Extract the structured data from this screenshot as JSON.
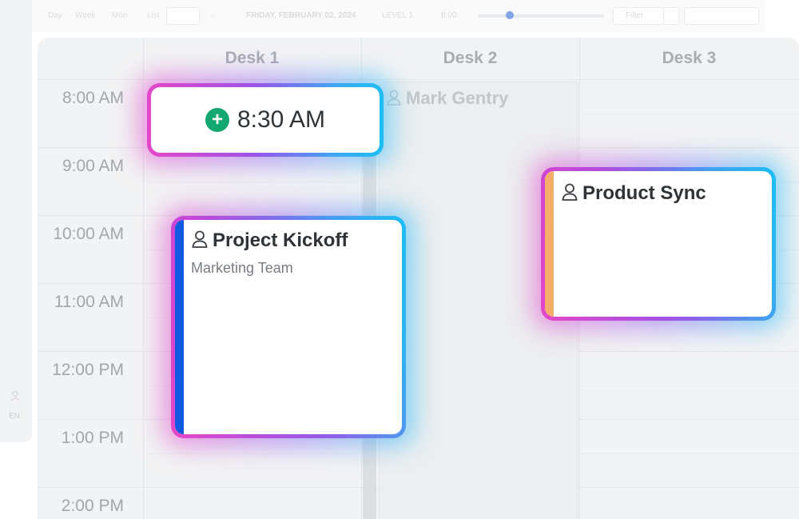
{
  "sidebar": {
    "language_code": "EN"
  },
  "toolbar": {
    "day_label": "Day",
    "week_label": "Week",
    "month_label": "Mon",
    "list_label": "List",
    "date_text": "FRIDAY, FEBRUARY 02, 2024",
    "level_label": "LEVEL 1",
    "time_label": "8:00",
    "filter_label": "Filter",
    "zoom_fraction": 0.25
  },
  "calendar": {
    "desks": [
      "Desk 1",
      "Desk 2",
      "Desk 3"
    ],
    "times": [
      "8:00 AM",
      "9:00 AM",
      "10:00 AM",
      "11:00 AM",
      "12:00 PM",
      "1:00 PM",
      "2:00 PM"
    ],
    "desk2_booking": {
      "person": "Mark Gentry"
    }
  },
  "events": {
    "new_booking_time": "8:30 AM",
    "kickoff": {
      "title": "Project Kickoff",
      "subtitle": "Marketing Team",
      "accent": "#1159e0"
    },
    "sync": {
      "title": "Product Sync",
      "accent": "#f7ad6a"
    }
  },
  "colors": {
    "add_button": "#13a86f",
    "highlight_gradient": [
      "#e94bc8",
      "#a64fe3",
      "#16c3f6"
    ]
  }
}
